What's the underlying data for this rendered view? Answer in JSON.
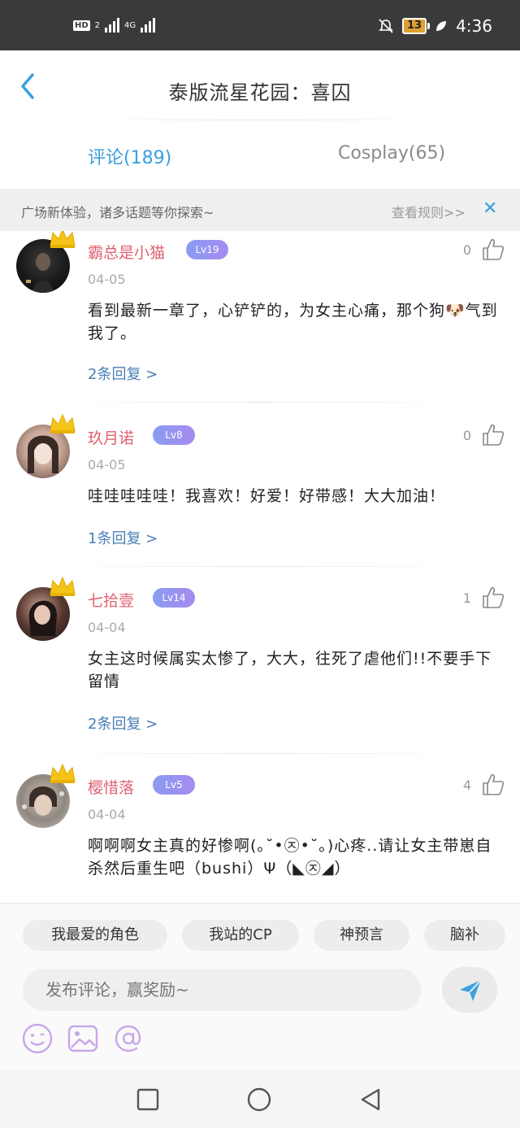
{
  "status_bar": {
    "network_hd": "HD",
    "sim": "2",
    "network_type": "4G",
    "battery": "13",
    "time": "4:36"
  },
  "header": {
    "title": "泰版流星花园：喜囚"
  },
  "tabs": [
    {
      "label": "评论(189)",
      "active": true
    },
    {
      "label": "Cosplay(65)",
      "active": false
    }
  ],
  "notice": {
    "text": "广场新体验，诸多话题等你探索~",
    "link": "查看规则>>"
  },
  "comments": [
    {
      "username": "霸总是小猫",
      "level": "Lv19",
      "date": "04-05",
      "likes": "0",
      "text": "看到最新一章了，心铲铲的，为女主心痛，那个狗🐶气到我了。",
      "replies": "2条回复 >"
    },
    {
      "username": "玖月诺",
      "level": "Lv8",
      "date": "04-05",
      "likes": "0",
      "text": "哇哇哇哇哇！我喜欢！好爱！好带感！大大加油！",
      "replies": "1条回复 >"
    },
    {
      "username": "七拾壹",
      "level": "Lv14",
      "date": "04-04",
      "likes": "1",
      "text": "女主这时候属实太惨了，大大，往死了虐他们!!不要手下留情",
      "replies": "2条回复 >"
    },
    {
      "username": "樱惜落",
      "level": "Lv5",
      "date": "04-04",
      "likes": "4",
      "text": "啊啊啊女主真的好惨啊(｡˘•㉨•˘｡)心疼..请让女主带崽自杀然后重生吧（bushi）Ψ（◣㉨◢）",
      "replies": ""
    }
  ],
  "composer": {
    "chips": [
      "我最爱的角色",
      "我站的CP",
      "神预言",
      "脑补"
    ],
    "placeholder": "发布评论，赢奖励~"
  },
  "colors": {
    "accent": "#3aa0e0",
    "username": "#e06070",
    "reply_link": "#4a7fb6",
    "level_badge": "#9a92f2"
  }
}
